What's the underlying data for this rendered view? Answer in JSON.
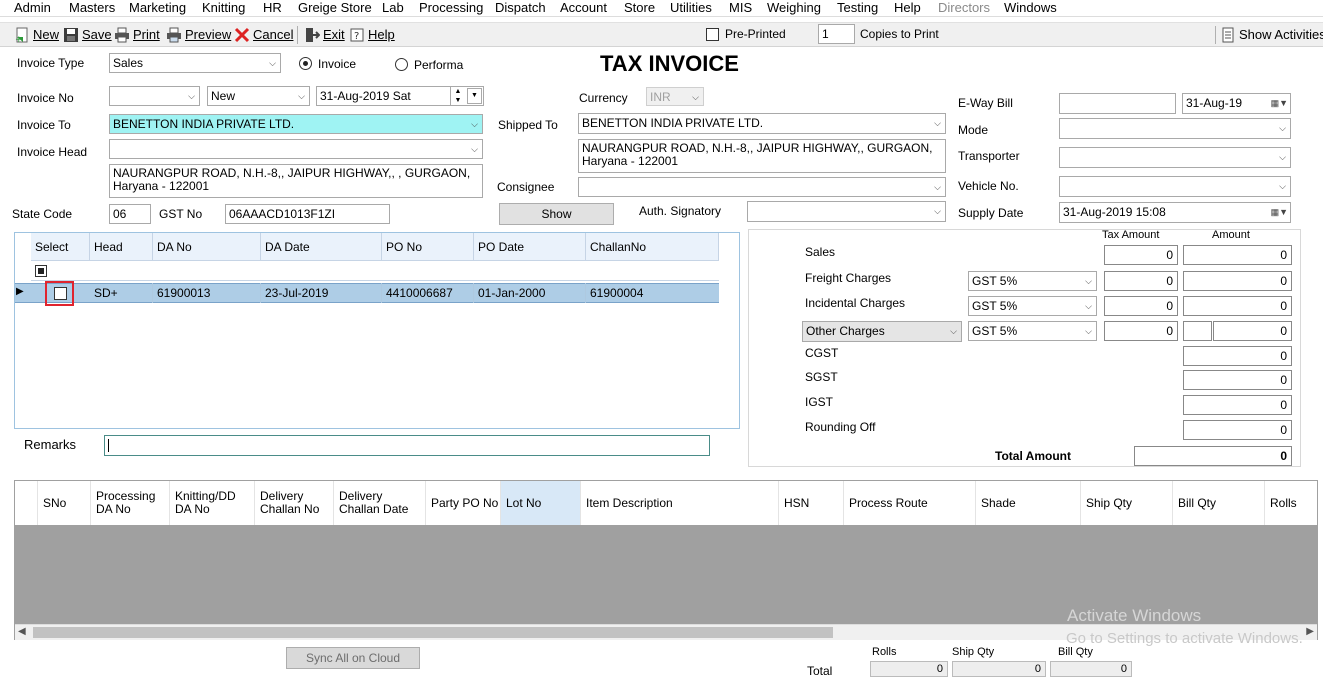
{
  "menu": [
    "Admin",
    "Masters",
    "Marketing",
    "Knitting",
    "HR",
    "Greige Store",
    "Lab",
    "Processing",
    "Dispatch",
    "Account",
    "Store",
    "Utilities",
    "MIS",
    "Weighing",
    "Testing",
    "Help",
    "Directors",
    "Windows"
  ],
  "toolbar": {
    "new": "New",
    "save": "Save",
    "print": "Print",
    "preview": "Preview",
    "cancel": "Cancel",
    "exit": "Exit",
    "help": "Help",
    "pre_printed": "Pre-Printed",
    "copies_value": "1",
    "copies_label": "Copies to Print",
    "show_activities": "Show Activities"
  },
  "form": {
    "title": "TAX INVOICE",
    "invoice_type_label": "Invoice Type",
    "invoice_type": "Sales",
    "radio_invoice": "Invoice",
    "radio_performa": "Performa",
    "invoice_no_label": "Invoice No",
    "invoice_no": "",
    "invoice_status": "New",
    "invoice_date": "31-Aug-2019  Sat",
    "invoice_to_label": "Invoice To",
    "invoice_to": "BENETTON INDIA PRIVATE LTD.",
    "invoice_head_label": "Invoice Head",
    "invoice_head": "",
    "address": "NAURANGPUR ROAD, N.H.-8,, JAIPUR HIGHWAY,, , GURGAON, Haryana - 122001",
    "state_code_label": "State Code",
    "state_code": "06",
    "gst_label": "GST No",
    "gst_no": "06AAACD1013F1ZI",
    "currency_label": "Currency",
    "currency": "INR",
    "shipped_to_label": "Shipped To",
    "shipped_to": "BENETTON INDIA PRIVATE LTD.",
    "shipped_address": "NAURANGPUR ROAD, N.H.-8,, JAIPUR HIGHWAY,, GURGAON, Haryana - 122001",
    "consignee_label": "Consignee",
    "consignee": "",
    "show_button": "Show",
    "auth_label": "Auth. Signatory",
    "auth": "",
    "eway_label": "E-Way Bill",
    "eway": "",
    "eway_date": "31-Aug-19",
    "mode_label": "Mode",
    "mode": "",
    "transporter_label": "Transporter",
    "transporter": "",
    "vehicle_label": "Vehicle No.",
    "vehicle": "",
    "supply_label": "Supply Date",
    "supply_date": "31-Aug-2019 15:08",
    "remarks_label": "Remarks",
    "remarks": ""
  },
  "da_grid": {
    "columns": [
      "Select",
      "Head",
      "DA No",
      "DA Date",
      "PO No",
      "PO Date",
      "ChallanNo"
    ],
    "row": {
      "head": "SD+",
      "da_no": "61900013",
      "da_date": "23-Jul-2019",
      "po_no": "4410006687",
      "po_date": "01-Jan-2000",
      "challan": "61900004"
    }
  },
  "charges": {
    "tax_amount_label": "Tax Amount",
    "amount_label": "Amount",
    "sales": "Sales",
    "freight": "Freight Charges",
    "incidental": "Incidental Charges",
    "other": "Other Charges",
    "cgst": "CGST",
    "sgst": "SGST",
    "igst": "IGST",
    "rounding": "Rounding Off",
    "total": "Total Amount",
    "gst_rate": "GST 5%",
    "zero": "0"
  },
  "lot_grid": {
    "columns": [
      "SNo",
      "Processing DA No",
      "Knitting/DD DA No",
      "Delivery Challan No",
      "Delivery Challan Date",
      "Party PO No",
      "Lot No",
      "Item Description",
      "HSN",
      "Process Route",
      "Shade",
      "Ship Qty",
      "Bill Qty",
      "Rolls"
    ]
  },
  "footer": {
    "sync_button": "Sync All on Cloud",
    "total_label": "Total",
    "rolls": "Rolls",
    "ship_qty": "Ship Qty",
    "bill_qty": "Bill Qty",
    "rolls_val": "0",
    "ship_val": "0",
    "bill_val": "0"
  },
  "watermark": {
    "line1": "Activate Windows",
    "line2": "Go to Settings to activate Windows."
  }
}
